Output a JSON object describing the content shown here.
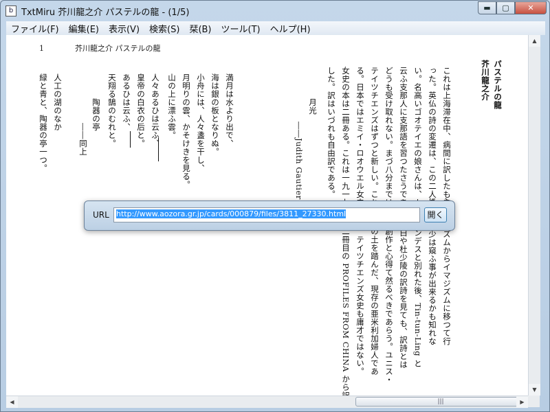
{
  "window": {
    "title": "TxtMiru 芥川龍之介 パステルの龍 - (1/5)",
    "minimize": "▬",
    "maximize": "▢",
    "close": "✕"
  },
  "menu": [
    "ファイル(F)",
    "編集(E)",
    "表示(V)",
    "検索(S)",
    "栞(B)",
    "ツール(T)",
    "ヘルプ(H)"
  ],
  "page": {
    "number": "1",
    "header": "芥川龍之介 パステルの龍",
    "right_columns": [
      "パステルの龍",
      "芥川龍之介",
      "これは上海滞在中、病間に訳したもの",
      "った。英仏の詩の変遷は、この二人の女",
      "い。名高いゴオテイエの娘さんは、カテ",
      "云ふ支那人に支那語を習つたさうである",
      "どうも受け取れない。まづ八分までは女",
      "テイツチエンズはずつと新しい。これは",
      "る。日本ではエミイ・ロオウエル女史が",
      "女史の本は二冊ある。これは一九一七年",
      "した。訳はいづれも自由訳である。"
    ],
    "lower_columns": [
      "シムボリズムからイマジズムに移つて行",
      "にも、多少は窺ふ事が出来るかも知れな",
      "マンデスと別れた後、Tin-tun-Ling と",
      "太白や杜少陵の訳詩を見ても、訳詩とは",
      "創作と心得て然るべきであらう。ユニス・",
      "の土を踏んだ、現存の亜米利加婦人であ",
      "、テイツチエンズ女史も庸才ではない。",
      "二冊目の PROFILES FROM CHINA から訳"
    ],
    "author_line": "――Judith Gautier",
    "poem1_title": "月光",
    "poem1_lines": [
      "満月は水より出で、",
      "海は銀の板となりぬ。",
      "小舟には、人々盞を干し、",
      "月明りの雲、かそけきを見る。",
      "山の上に漂ふ雲。"
    ],
    "poem2_lines": [
      "人々あるひは云ふ、",
      "皇帝の白衣の后と。",
      "あるひは云ふ、",
      "天翔る鵠のむれと。"
    ],
    "poem2_attrib": "――同上",
    "poem3_title": "陶器の亭",
    "poem3_lines": [
      "人工の湖のなか",
      "緑と青と、陶器の亭一つ。"
    ]
  },
  "url_dialog": {
    "label": "URL",
    "value": "http://www.aozora.gr.jp/cards/000879/files/3811_27330.html",
    "open_button": "開く"
  },
  "scrollbar": {
    "up": "▲",
    "down": "▼",
    "left": "◀",
    "right": "▶",
    "grip": "|||"
  }
}
